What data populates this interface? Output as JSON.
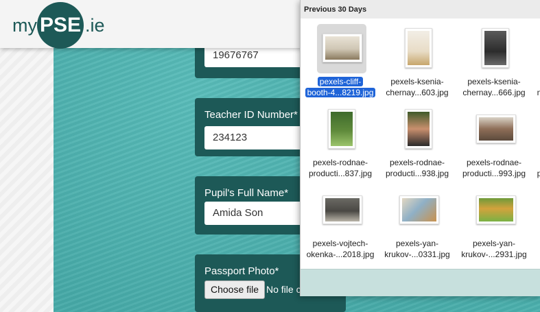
{
  "header": {
    "logo": {
      "prefix": "my",
      "circle_text": "PSE",
      "suffix": ".ie"
    }
  },
  "form": {
    "student_number_value": "19676767",
    "teacher_id_label": "Teacher ID Number*",
    "teacher_id_value": "234123",
    "pupil_name_label": "Pupil's Full Name*",
    "pupil_name_value": "Amida Son",
    "passport_photo_label": "Passport Photo*",
    "choose_file_label": "Choose file",
    "no_file_text": "No file c"
  },
  "picker": {
    "section_title": "Previous 30 Days",
    "files": [
      {
        "line1": "pexels-cliff-",
        "line2": "booth-4...8219.jpg",
        "selected": true
      },
      {
        "line1": "pexels-ksenia-",
        "line2": "chernay...603.jpg",
        "selected": false
      },
      {
        "line1": "pexels-ksenia-",
        "line2": "chernay...666.jpg",
        "selected": false
      },
      {
        "line1": "n",
        "line2": "",
        "selected": false
      },
      {
        "line1": "pexels-rodnae-",
        "line2": "producti...837.jpg",
        "selected": false
      },
      {
        "line1": "pexels-rodnae-",
        "line2": "producti...938.jpg",
        "selected": false
      },
      {
        "line1": "pexels-rodnae-",
        "line2": "producti...993.jpg",
        "selected": false
      },
      {
        "line1": "p",
        "line2": "",
        "selected": false
      },
      {
        "line1": "pexels-vojtech-",
        "line2": "okenka-...2018.jpg",
        "selected": false
      },
      {
        "line1": "pexels-yan-",
        "line2": "krukov-...0331.jpg",
        "selected": false
      },
      {
        "line1": "pexels-yan-",
        "line2": "krukov-...2931.jpg",
        "selected": false
      }
    ]
  },
  "colors": {
    "brand_dark": "#1d5957",
    "teal_background": "#4eb2b0",
    "selection_blue": "#1f64d8"
  }
}
